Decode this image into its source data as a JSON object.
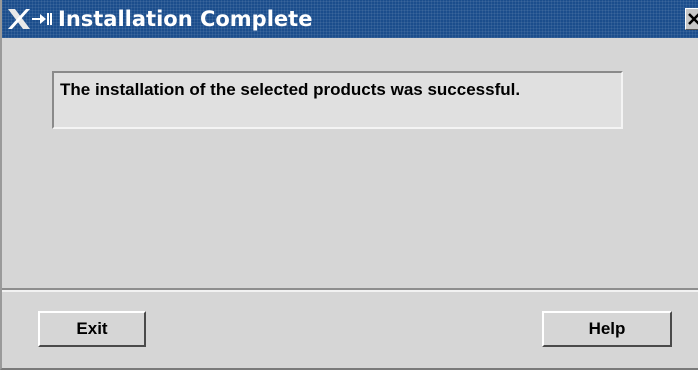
{
  "window": {
    "title": "Installation Complete",
    "icons": {
      "app": "x-logo-icon",
      "minimize": "minimize-icon",
      "close": "close-icon"
    },
    "colors": {
      "titlebar": "#1b4d8c",
      "body": "#d6d6d6"
    }
  },
  "message": {
    "text": "The installation of the selected products was successful."
  },
  "buttons": {
    "exit_label": "Exit",
    "help_label": "Help"
  }
}
